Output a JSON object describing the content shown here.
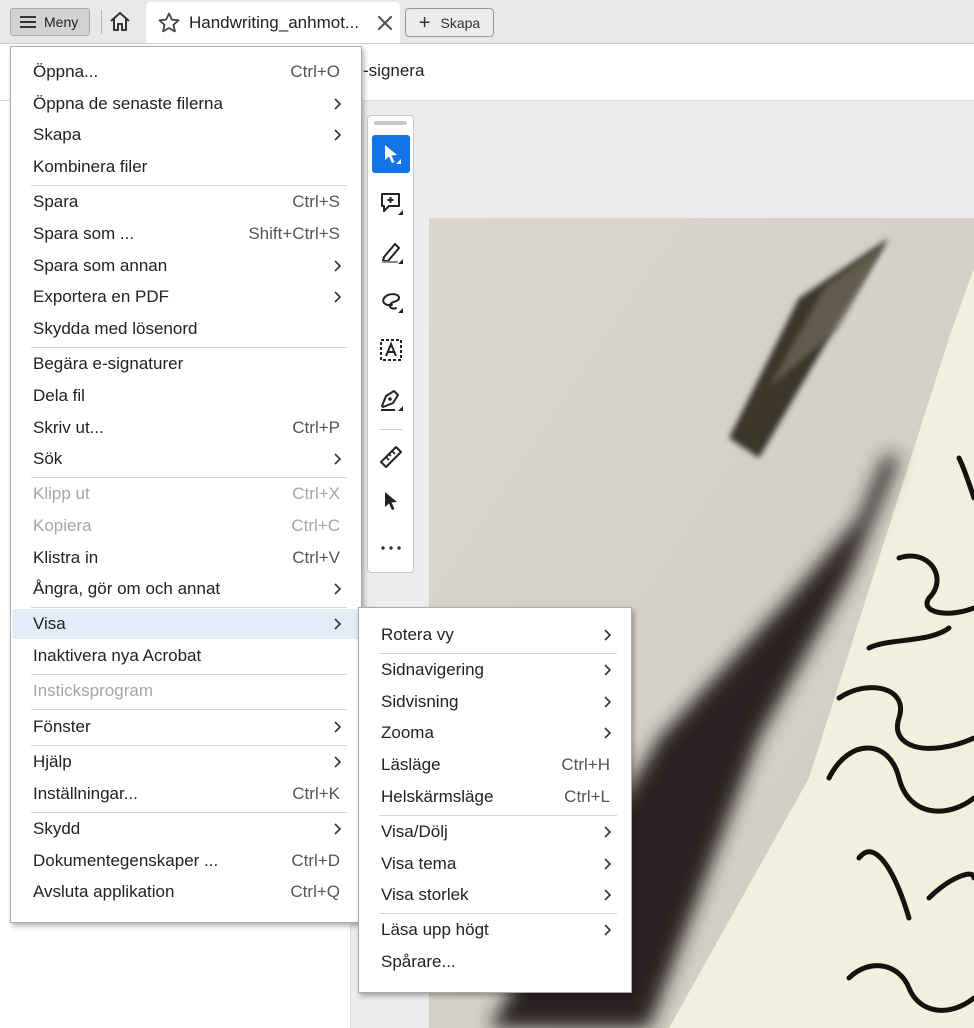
{
  "tabbar": {
    "menu_label": "Meny",
    "tab_title": "Handwriting_anhmot...",
    "new_label": "Skapa"
  },
  "toolbar": {
    "esign_label": "-signera"
  },
  "main_menu": {
    "items": [
      {
        "label": "Öppna...",
        "shortcut": "Ctrl+O",
        "submenu": false,
        "disabled": false
      },
      {
        "label": "Öppna de senaste filerna",
        "shortcut": "",
        "submenu": true,
        "disabled": false
      },
      {
        "label": "Skapa",
        "shortcut": "",
        "submenu": true,
        "disabled": false
      },
      {
        "label": "Kombinera filer",
        "shortcut": "",
        "submenu": false,
        "disabled": false
      },
      {
        "label": "Spara",
        "shortcut": "Ctrl+S",
        "submenu": false,
        "disabled": false
      },
      {
        "label": "Spara som ...",
        "shortcut": "Shift+Ctrl+S",
        "submenu": false,
        "disabled": false
      },
      {
        "label": "Spara som annan",
        "shortcut": "",
        "submenu": true,
        "disabled": false
      },
      {
        "label": "Exportera en PDF",
        "shortcut": "",
        "submenu": true,
        "disabled": false
      },
      {
        "label": "Skydda med lösenord",
        "shortcut": "",
        "submenu": false,
        "disabled": false
      },
      {
        "label": "Begära e-signaturer",
        "shortcut": "",
        "submenu": false,
        "disabled": false
      },
      {
        "label": "Dela fil",
        "shortcut": "",
        "submenu": false,
        "disabled": false
      },
      {
        "label": "Skriv ut...",
        "shortcut": "Ctrl+P",
        "submenu": false,
        "disabled": false
      },
      {
        "label": "Sök",
        "shortcut": "",
        "submenu": true,
        "disabled": false
      },
      {
        "label": "Klipp ut",
        "shortcut": "Ctrl+X",
        "submenu": false,
        "disabled": true
      },
      {
        "label": "Kopiera",
        "shortcut": "Ctrl+C",
        "submenu": false,
        "disabled": true
      },
      {
        "label": "Klistra in",
        "shortcut": "Ctrl+V",
        "submenu": false,
        "disabled": false
      },
      {
        "label": "Ångra, gör om och annat",
        "shortcut": "",
        "submenu": true,
        "disabled": false
      },
      {
        "label": "Visa",
        "shortcut": "",
        "submenu": true,
        "disabled": false,
        "highlighted": true
      },
      {
        "label": "Inaktivera nya Acrobat",
        "shortcut": "",
        "submenu": false,
        "disabled": false
      },
      {
        "label": "Insticksprogram",
        "shortcut": "",
        "submenu": false,
        "disabled": true
      },
      {
        "label": "Fönster",
        "shortcut": "",
        "submenu": true,
        "disabled": false
      },
      {
        "label": "Hjälp",
        "shortcut": "",
        "submenu": true,
        "disabled": false
      },
      {
        "label": "Inställningar...",
        "shortcut": "Ctrl+K",
        "submenu": false,
        "disabled": false
      },
      {
        "label": "Skydd",
        "shortcut": "",
        "submenu": true,
        "disabled": false
      },
      {
        "label": "Dokumentegenskaper ...",
        "shortcut": "Ctrl+D",
        "submenu": false,
        "disabled": false
      },
      {
        "label": "Avsluta applikation",
        "shortcut": "Ctrl+Q",
        "submenu": false,
        "disabled": false
      }
    ]
  },
  "view_menu": {
    "items": [
      {
        "label": "Rotera vy",
        "shortcut": "",
        "submenu": true
      },
      {
        "label": "Sidnavigering",
        "shortcut": "",
        "submenu": true
      },
      {
        "label": "Sidvisning",
        "shortcut": "",
        "submenu": true
      },
      {
        "label": "Zooma",
        "shortcut": "",
        "submenu": true
      },
      {
        "label": "Läsläge",
        "shortcut": "Ctrl+H",
        "submenu": false
      },
      {
        "label": "Helskärmsläge",
        "shortcut": "Ctrl+L",
        "submenu": false
      },
      {
        "label": "Visa/Dölj",
        "shortcut": "",
        "submenu": true
      },
      {
        "label": "Visa tema",
        "shortcut": "",
        "submenu": true
      },
      {
        "label": "Visa storlek",
        "shortcut": "",
        "submenu": true
      },
      {
        "label": "Läsa upp högt",
        "shortcut": "",
        "submenu": true
      },
      {
        "label": "Spårare...",
        "shortcut": "",
        "submenu": false
      }
    ]
  },
  "tools": [
    {
      "icon": "select-arrow-icon",
      "active": true
    },
    {
      "icon": "add-comment-icon",
      "active": false
    },
    {
      "icon": "highlight-pen-icon",
      "active": false
    },
    {
      "icon": "draw-freeform-icon",
      "active": false
    },
    {
      "icon": "text-recognition-icon",
      "active": false
    },
    {
      "icon": "fill-sign-icon",
      "active": false
    },
    {
      "icon": "measure-ruler-icon",
      "active": false
    },
    {
      "icon": "pointer-icon",
      "active": false
    },
    {
      "icon": "more-tools-icon",
      "active": false
    }
  ],
  "colors": {
    "accent": "#1473e6",
    "menu_highlight": "#e3edf8",
    "disabled_text": "#a6a6a6"
  }
}
